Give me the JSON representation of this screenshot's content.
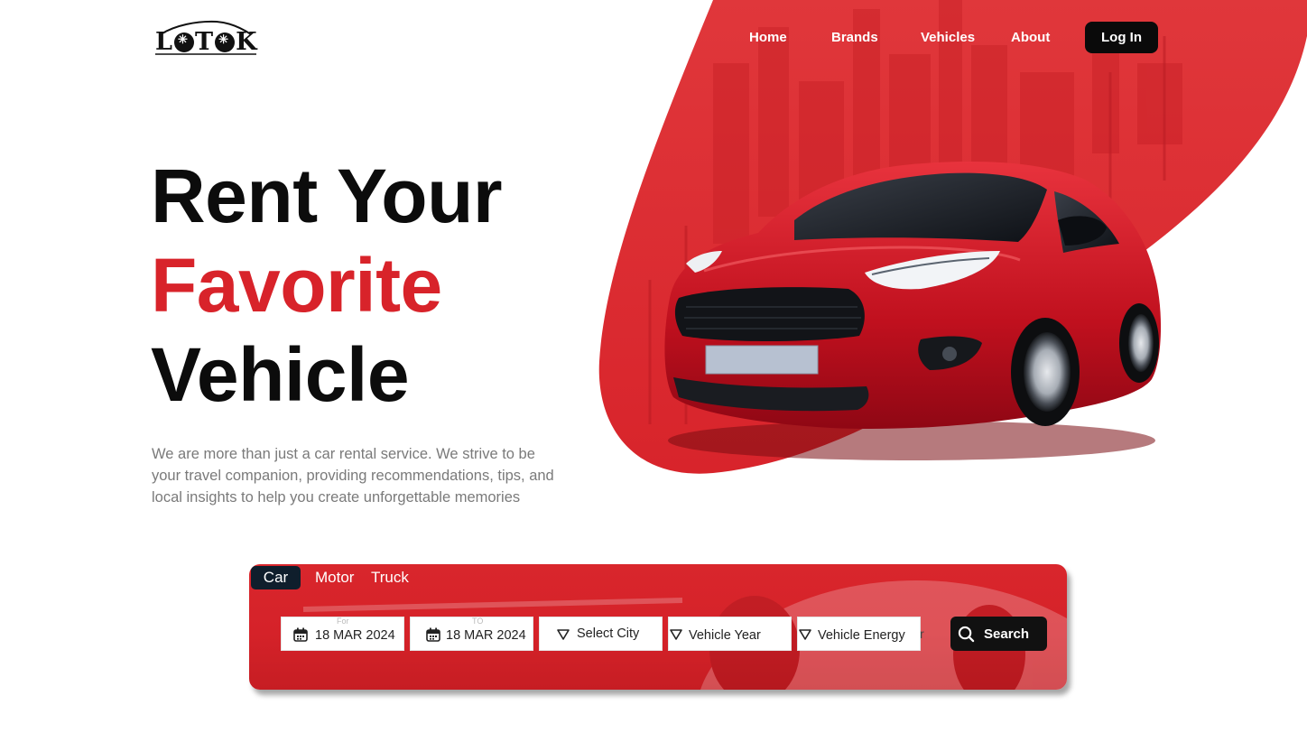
{
  "brand": {
    "logo_text": "LOTOK"
  },
  "nav": {
    "items": [
      "Home",
      "Brands",
      "Vehicles",
      "About"
    ],
    "login": "Log In"
  },
  "hero": {
    "line1": "Rent Your",
    "line2": "Favorite",
    "line3": "Vehicle",
    "description": "We are more than just a car rental service. We strive to be your travel companion, providing recommendations, tips, and local insights to help you create unforgettable memories"
  },
  "search": {
    "tabs": [
      "Car",
      "Motor",
      "Truck"
    ],
    "active_tab": "Car",
    "from": {
      "label": "For",
      "value": "18 MAR 2024"
    },
    "to": {
      "label": "TO",
      "value": "18 MAR 2024"
    },
    "city": "Select  City",
    "year": "Vehicle Year",
    "energy": "Vehicle Energy",
    "stray_char": "r",
    "button": "Search"
  },
  "colors": {
    "accent_red": "#d8232a",
    "dark": "#0a0a0a",
    "tab_active": "#0f1e2c",
    "text_muted": "#7a7a7a"
  },
  "icons": {
    "date": "calendar-icon",
    "dropdown": "filter-triangle-icon",
    "search": "magnifier-icon"
  }
}
